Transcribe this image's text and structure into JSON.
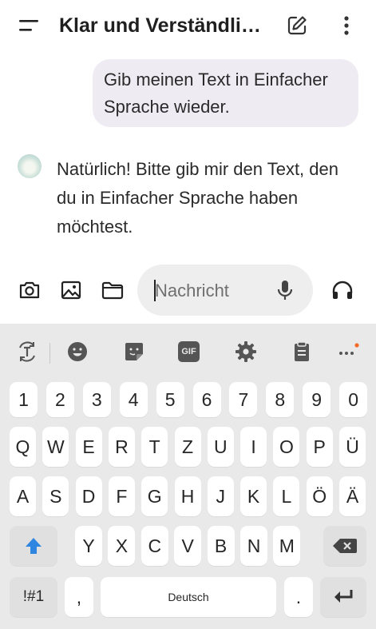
{
  "header": {
    "title": "Klar und Verständli…"
  },
  "conversation": {
    "user_message": "Gib meinen Text in Einfacher Sprache wieder.",
    "assistant_message": "Natürlich! Bitte gib mir den Text, den du in Einfacher Sprache haben möchtest."
  },
  "composer": {
    "placeholder": "Nachricht",
    "icons": [
      "camera-icon",
      "image-icon",
      "folder-icon",
      "microphone-icon",
      "headphones-icon"
    ]
  },
  "keyboard": {
    "toolbar_icons": [
      "translate-icon",
      "emoji-icon",
      "sticker-icon",
      "gif-icon",
      "settings-icon",
      "clipboard-icon",
      "more-icon"
    ],
    "gif_label": "GIF",
    "number_row": [
      "1",
      "2",
      "3",
      "4",
      "5",
      "6",
      "7",
      "8",
      "9",
      "0"
    ],
    "row1": [
      "Q",
      "W",
      "E",
      "R",
      "T",
      "Z",
      "U",
      "I",
      "O",
      "P",
      "Ü"
    ],
    "row2": [
      "A",
      "S",
      "D",
      "F",
      "G",
      "H",
      "J",
      "K",
      "L",
      "Ö",
      "Ä"
    ],
    "row3": [
      "Y",
      "X",
      "C",
      "V",
      "B",
      "N",
      "M"
    ],
    "symbols_label": "!#1",
    "comma_label": ",",
    "space_label": "Deutsch",
    "period_label": ".",
    "accent_color": "#2f86e0",
    "notification_dot_color": "#f36a2a"
  }
}
